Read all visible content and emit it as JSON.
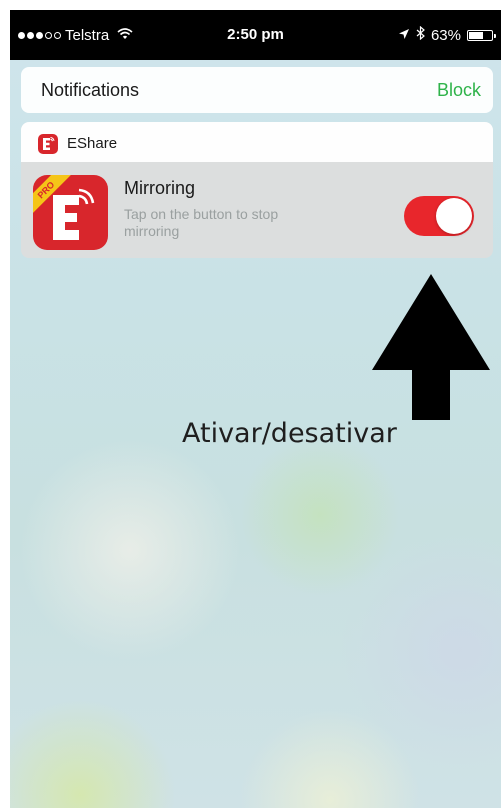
{
  "status_bar": {
    "carrier": "Telstra",
    "signal_bars_filled": 3,
    "signal_bars_total": 5,
    "time": "2:50 pm",
    "battery_percent": "63%",
    "battery_level": 0.63
  },
  "notifications_bar": {
    "title": "Notifications",
    "block_label": "Block"
  },
  "app": {
    "name": "EShare",
    "badge": "PRO",
    "icon_letter": "E"
  },
  "notification": {
    "title": "Mirroring",
    "subtitle": "Tap on the button to stop mirroring",
    "toggle_on": true
  },
  "annotation": {
    "label": "Ativar/desativar"
  },
  "colors": {
    "accent_green": "#2fb34a",
    "brand_red": "#d8262c",
    "toggle_red": "#e8262c"
  },
  "icons": [
    "wifi-icon",
    "location-arrow-icon",
    "bluetooth-icon",
    "battery-icon",
    "eshare-app-icon",
    "up-arrow-icon"
  ]
}
